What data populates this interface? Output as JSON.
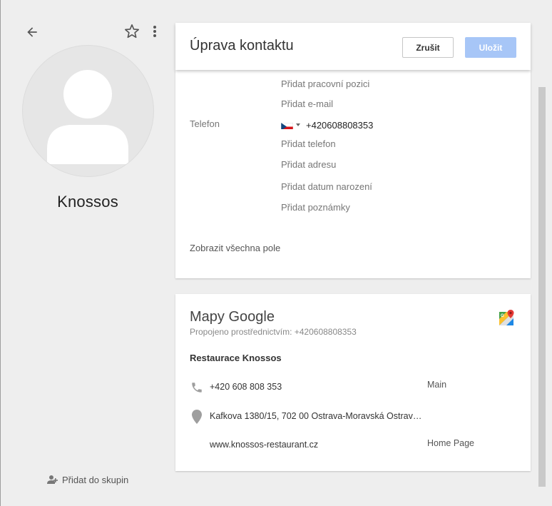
{
  "profile": {
    "name": "Knossos",
    "add_to_group_label": "Přidat do skupin"
  },
  "edit": {
    "title": "Úprava kontaktu",
    "cancel_label": "Zrušit",
    "save_label": "Uložit",
    "add_job_label": "Přidat pracovní pozici",
    "add_email_label": "Přidat e-mail",
    "phone_label": "Telefon",
    "phone_value": "+420608808353",
    "add_phone_label": "Přidat telefon",
    "add_address_label": "Přidat adresu",
    "add_birthday_label": "Přidat datum narození",
    "add_notes_label": "Přidat poznámky",
    "show_all_fields_label": "Zobrazit všechna pole"
  },
  "maps": {
    "title": "Mapy Google",
    "subtitle": "Propojeno prostřednictvím: +420608808353",
    "place_name": "Restaurace Knossos",
    "phone": "+420 608 808 353",
    "phone_tag": "Main",
    "address": "Kafkova 1380/15, 702 00 Ostrava-Moravská Ostrav…",
    "website": "www.knossos-restaurant.cz",
    "website_tag": "Home Page"
  },
  "icons": {
    "back": "arrow-back-icon",
    "star": "star-outline-icon",
    "more": "more-vert-icon",
    "group": "add-group-icon",
    "flag": "czech-flag-icon",
    "maps": "google-maps-icon",
    "phone": "phone-icon",
    "place": "place-pin-icon"
  },
  "colors": {
    "background": "#eeeeee",
    "card": "#ffffff",
    "save_button": "#a7c6f7",
    "icon_gray": "#9e9e9e"
  }
}
